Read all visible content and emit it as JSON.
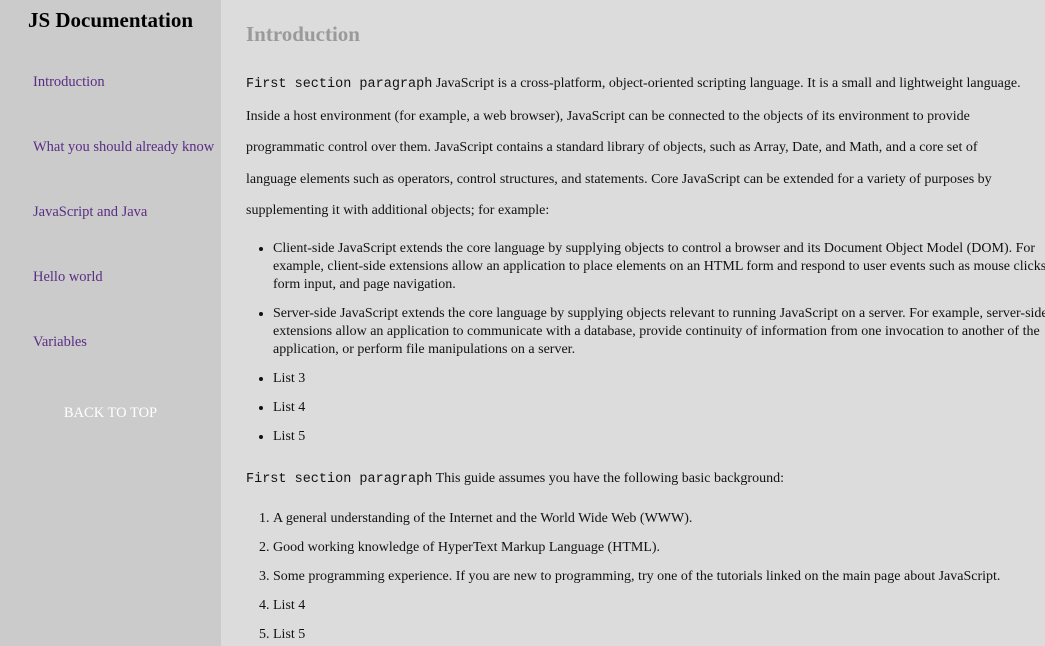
{
  "sidebar": {
    "title": "JS Documentation",
    "links": [
      "Introduction",
      "What you should already know",
      "JavaScript and Java",
      "Hello world",
      "Variables"
    ],
    "back_to_top": "BACK TO TOP"
  },
  "main": {
    "section_title": "Introduction",
    "para1_code": "First section paragraph",
    "para1_text": " JavaScript is a cross-platform, object-oriented scripting language. It is a small and lightweight language. Inside a host environment (for example, a web browser), JavaScript can be connected to the objects of its environment to provide programmatic control over them. JavaScript contains a standard library of objects, such as Array, Date, and Math, and a core set of language elements such as operators, control structures, and statements. Core JavaScript can be extended for a variety of purposes by supplementing it with additional objects; for example:",
    "bullets": [
      "Client-side JavaScript extends the core language by supplying objects to control a browser and its Document Object Model (DOM). For example, client-side extensions allow an application to place elements on an HTML form and respond to user events such as mouse clicks, form input, and page navigation.",
      "Server-side JavaScript extends the core language by supplying objects relevant to running JavaScript on a server. For example, server-side extensions allow an application to communicate with a database, provide continuity of information from one invocation to another of the application, or perform file manipulations on a server.",
      "List 3",
      "List 4",
      "List 5"
    ],
    "para2_code": "First section paragraph",
    "para2_text": " This guide assumes you have the following basic background:",
    "numbered": [
      "A general understanding of the Internet and the World Wide Web (WWW).",
      "Good working knowledge of HyperText Markup Language (HTML).",
      "Some programming experience. If you are new to programming, try one of the tutorials linked on the main page about JavaScript.",
      "List 4",
      "List 5"
    ]
  }
}
